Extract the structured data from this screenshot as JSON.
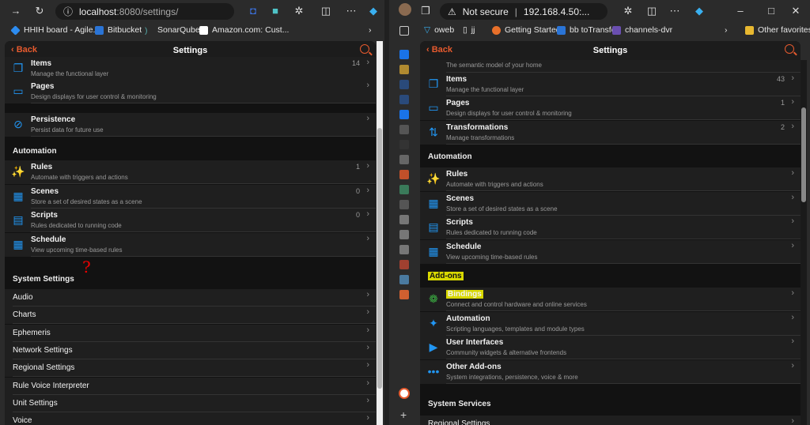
{
  "left": {
    "url_host": "localhost",
    "url_path": ":8080/settings/",
    "bookmarks": [
      "HHIH board - Agile...",
      "Bitbucket",
      "SonarQube",
      "Amazon.com: Cust..."
    ],
    "header": {
      "back": "Back",
      "title": "Settings"
    },
    "rows": [
      {
        "title": "Items",
        "subtitle": "Manage the functional layer",
        "count": "14",
        "icon": "items-icon",
        "glyph": "❐"
      },
      {
        "title": "Pages",
        "subtitle": "Design displays for user control & monitoring",
        "count": "",
        "icon": "monitor-icon",
        "glyph": "▭"
      },
      {
        "title": "Persistence",
        "subtitle": "Persist data for future use",
        "count": "",
        "icon": "persistence-icon",
        "glyph": "⊘"
      },
      {
        "title": "Rules",
        "subtitle": "Automate with triggers and actions",
        "count": "1",
        "icon": "magic-wand-icon",
        "glyph": "✨"
      },
      {
        "title": "Scenes",
        "subtitle": "Store a set of desired states as a scene",
        "count": "0",
        "icon": "film-icon",
        "glyph": "▦"
      },
      {
        "title": "Scripts",
        "subtitle": "Rules dedicated to running code",
        "count": "0",
        "icon": "script-icon",
        "glyph": "▤"
      },
      {
        "title": "Schedule",
        "subtitle": "View upcoming time-based rules",
        "count": "",
        "icon": "calendar-icon",
        "glyph": "▦"
      }
    ],
    "sections": {
      "automation": "Automation",
      "system": "System Settings"
    },
    "annotation": "?",
    "system_items": [
      "Audio",
      "Charts",
      "Ephemeris",
      "Network Settings",
      "Regional Settings",
      "Rule Voice Interpreter",
      "Unit Settings",
      "Voice"
    ]
  },
  "right": {
    "security": "Not secure",
    "url": "192.168.4.50:...",
    "bookmarks": [
      "oweb",
      "jj",
      "Getting Started",
      "bb toTransfer",
      "channels-dvr"
    ],
    "other_favorites": "Other favorites",
    "header": {
      "back": "Back",
      "title": "Settings"
    },
    "partial_subtitle": "The semantic model of your home",
    "rows": [
      {
        "title": "Items",
        "subtitle": "Manage the functional layer",
        "count": "43",
        "icon": "items-icon",
        "glyph": "❐"
      },
      {
        "title": "Pages",
        "subtitle": "Design displays for user control & monitoring",
        "count": "1",
        "icon": "monitor-icon",
        "glyph": "▭"
      },
      {
        "title": "Transformations",
        "subtitle": "Manage transformations",
        "count": "2",
        "icon": "transform-icon",
        "glyph": "⇅"
      },
      {
        "title": "Rules",
        "subtitle": "Automate with triggers and actions",
        "count": "",
        "icon": "magic-wand-icon",
        "glyph": "✨"
      },
      {
        "title": "Scenes",
        "subtitle": "Store a set of desired states as a scene",
        "count": "",
        "icon": "film-icon",
        "glyph": "▦"
      },
      {
        "title": "Scripts",
        "subtitle": "Rules dedicated to running code",
        "count": "",
        "icon": "script-icon",
        "glyph": "▤"
      },
      {
        "title": "Schedule",
        "subtitle": "View upcoming time-based rules",
        "count": "",
        "icon": "calendar-icon",
        "glyph": "▦"
      },
      {
        "title": "Bindings",
        "subtitle": "Connect and control hardware and online services",
        "count": "",
        "icon": "bindings-icon",
        "glyph": "❁"
      },
      {
        "title": "Automation",
        "subtitle": "Scripting languages, templates and module types",
        "count": "",
        "icon": "sparkle-icon",
        "glyph": "✦"
      },
      {
        "title": "User Interfaces",
        "subtitle": "Community widgets & alternative frontends",
        "count": "",
        "icon": "play-screen-icon",
        "glyph": "▶"
      },
      {
        "title": "Other Add-ons",
        "subtitle": "System integrations, persistence, voice & more",
        "count": "",
        "icon": "more-dots-icon",
        "glyph": "•••"
      }
    ],
    "sections": {
      "automation": "Automation",
      "addons": "Add-ons",
      "system": "System Services"
    },
    "system_items": [
      "Regional Settings"
    ]
  },
  "colors": {
    "accent": "#e65a2e",
    "icon": "#2196f3",
    "highlight": "#d8d800"
  }
}
